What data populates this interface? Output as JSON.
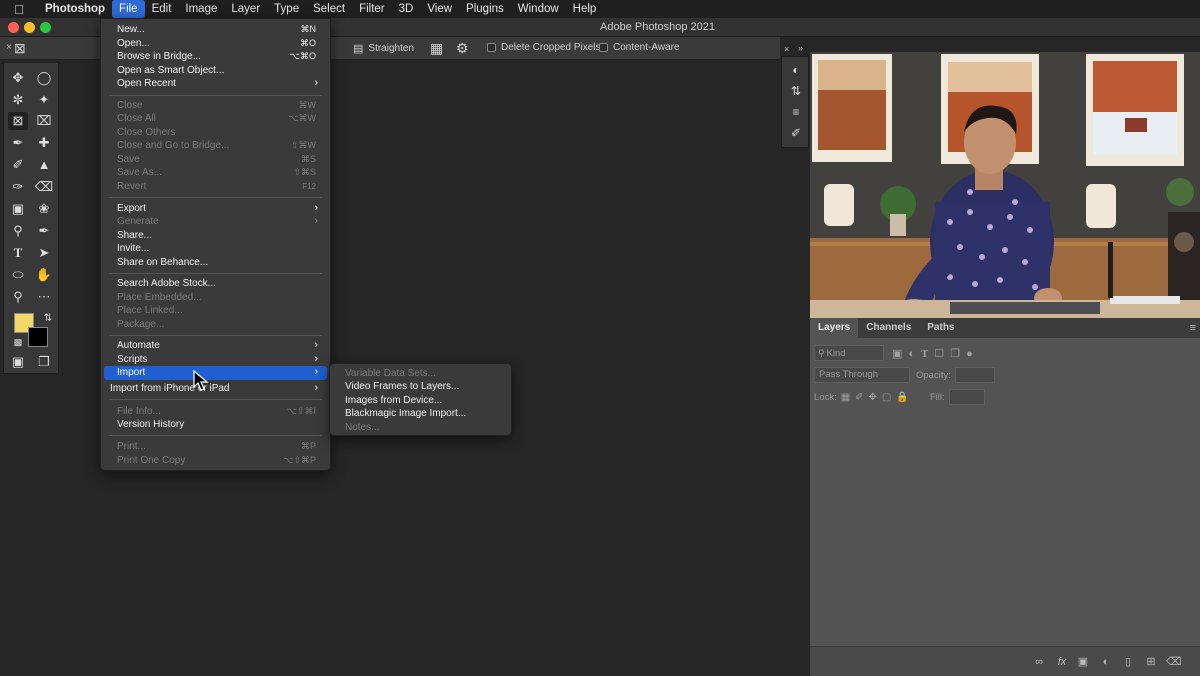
{
  "menubar": {
    "app": "Photoshop",
    "items": [
      "File",
      "Edit",
      "Image",
      "Layer",
      "Type",
      "Select",
      "Filter",
      "3D",
      "View",
      "Plugins",
      "Window",
      "Help"
    ]
  },
  "window": {
    "title": "Adobe Photoshop 2021"
  },
  "options_bar": {
    "straighten": "Straighten",
    "delete_cropped": "Delete Cropped Pixels",
    "content_aware": "Content-Aware"
  },
  "file_menu": {
    "new": {
      "label": "New...",
      "shortcut": "⌘N"
    },
    "open": {
      "label": "Open...",
      "shortcut": "⌘O"
    },
    "browse": {
      "label": "Browse in Bridge...",
      "shortcut": "⌥⌘O"
    },
    "open_smart": {
      "label": "Open as Smart Object..."
    },
    "open_recent": {
      "label": "Open Recent"
    },
    "close": {
      "label": "Close",
      "shortcut": "⌘W"
    },
    "close_all": {
      "label": "Close All",
      "shortcut": "⌥⌘W"
    },
    "close_others": {
      "label": "Close Others"
    },
    "close_bridge": {
      "label": "Close and Go to Bridge...",
      "shortcut": "⇧⌘W"
    },
    "save": {
      "label": "Save",
      "shortcut": "⌘S"
    },
    "save_as": {
      "label": "Save As...",
      "shortcut": "⇧⌘S"
    },
    "revert": {
      "label": "Revert",
      "shortcut": "F12"
    },
    "export": {
      "label": "Export"
    },
    "generate": {
      "label": "Generate"
    },
    "share": {
      "label": "Share..."
    },
    "invite": {
      "label": "Invite..."
    },
    "behance": {
      "label": "Share on Behance..."
    },
    "stock": {
      "label": "Search Adobe Stock..."
    },
    "place_embedded": {
      "label": "Place Embedded..."
    },
    "place_linked": {
      "label": "Place Linked..."
    },
    "package": {
      "label": "Package..."
    },
    "automate": {
      "label": "Automate"
    },
    "scripts": {
      "label": "Scripts"
    },
    "import": {
      "label": "Import"
    },
    "import_iphone": {
      "label": "Import from iPhone or iPad"
    },
    "file_info": {
      "label": "File Info...",
      "shortcut": "⌥⇧⌘I"
    },
    "version_history": {
      "label": "Version History"
    },
    "print": {
      "label": "Print...",
      "shortcut": "⌘P"
    },
    "print_one": {
      "label": "Print One Copy",
      "shortcut": "⌥⇧⌘P"
    }
  },
  "import_submenu": {
    "variable": "Variable Data Sets...",
    "video_frames": "Video Frames to Layers...",
    "images_device": "Images from Device...",
    "blackmagic": "Blackmagic Image Import...",
    "notes": "Notes..."
  },
  "layers_panel": {
    "tabs": [
      "Layers",
      "Channels",
      "Paths"
    ],
    "kind_placeholder": "Kind",
    "blend_mode": "Pass Through",
    "opacity_label": "Opacity:",
    "lock_label": "Lock:",
    "fill_label": "Fill:"
  },
  "colors": {
    "foreground": "#f2d967",
    "background": "#000000",
    "highlight": "#1f5fd2"
  }
}
